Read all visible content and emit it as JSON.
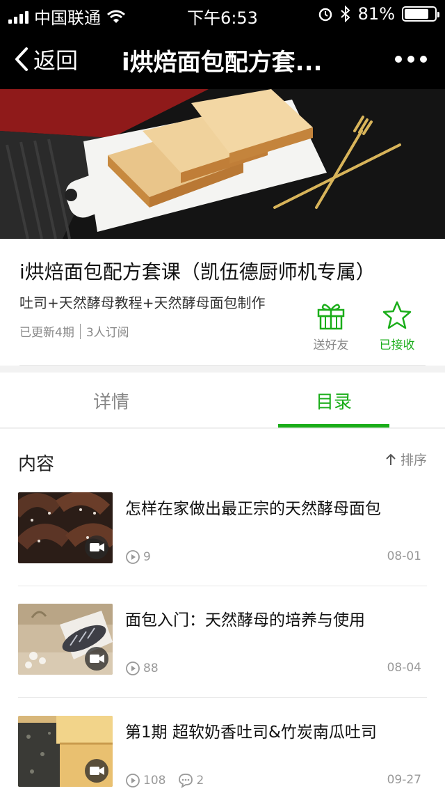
{
  "status_bar": {
    "carrier": "中国联通",
    "time": "下午6:53",
    "battery": "81%",
    "battery_level": 0.81
  },
  "nav": {
    "back_label": "返回",
    "title": "i烘焙面包配方套..."
  },
  "course": {
    "title": "i烘焙面包配方套课（凯伍德厨师机专属）",
    "subtitle": "吐司+天然酵母教程+天然酵母面包制作",
    "updated": "已更新4期",
    "subscribers": "3人订阅",
    "gift_label": "送好友",
    "received_label": "已接收"
  },
  "tabs": [
    {
      "label": "详情",
      "active": false
    },
    {
      "label": "目录",
      "active": true
    }
  ],
  "content": {
    "heading": "内容",
    "sort_label": "排序",
    "items": [
      {
        "title": "怎样在家做出最正宗的天然酵母面包",
        "plays": "9",
        "comments": "",
        "date": "08-01"
      },
      {
        "title": "面包入门：天然酵母的培养与使用",
        "plays": "88",
        "comments": "",
        "date": "08-04"
      },
      {
        "title": "第1期 超软奶香吐司&竹炭南瓜吐司",
        "plays": "108",
        "comments": "2",
        "date": "09-27"
      }
    ]
  },
  "colors": {
    "accent": "#1aad19",
    "bar": "#000000"
  }
}
